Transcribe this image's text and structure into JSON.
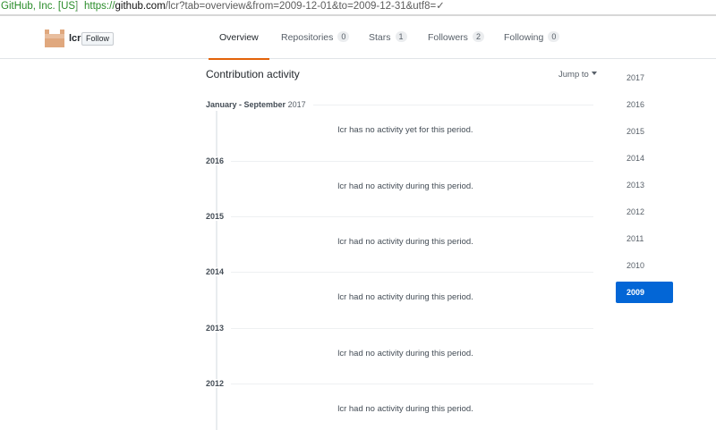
{
  "browser": {
    "secure_label": "GitHub, Inc. [US]",
    "url_scheme": "https://",
    "url_host": "github.com",
    "url_path": "/lcr?tab=overview&from=2009-12-01&to=2009-12-31&utf8=✓"
  },
  "profile": {
    "username": "lcr",
    "follow_label": "Follow",
    "avatar_color": "#e0a87e"
  },
  "tabs": [
    {
      "label": "Overview",
      "count": ""
    },
    {
      "label": "Repositories",
      "count": "0"
    },
    {
      "label": "Stars",
      "count": "1"
    },
    {
      "label": "Followers",
      "count": "2"
    },
    {
      "label": "Following",
      "count": "0"
    }
  ],
  "activity": {
    "title": "Contribution activity",
    "jump_label": "Jump to",
    "periods": [
      {
        "label": "January - September",
        "year": "2017",
        "message": "lcr has no activity yet for this period."
      },
      {
        "label": "2016",
        "year": "",
        "message": "lcr had no activity during this period."
      },
      {
        "label": "2015",
        "year": "",
        "message": "lcr had no activity during this period."
      },
      {
        "label": "2014",
        "year": "",
        "message": "lcr had no activity during this period."
      },
      {
        "label": "2013",
        "year": "",
        "message": "lcr had no activity during this period."
      },
      {
        "label": "2012",
        "year": "",
        "message": "lcr had no activity during this period."
      }
    ]
  },
  "years": [
    "2017",
    "2016",
    "2015",
    "2014",
    "2013",
    "2012",
    "2011",
    "2010",
    "2009"
  ],
  "selected_year": "2009",
  "colors": {
    "accent_tab": "#e36209",
    "selected_year_bg": "#0366d6"
  }
}
